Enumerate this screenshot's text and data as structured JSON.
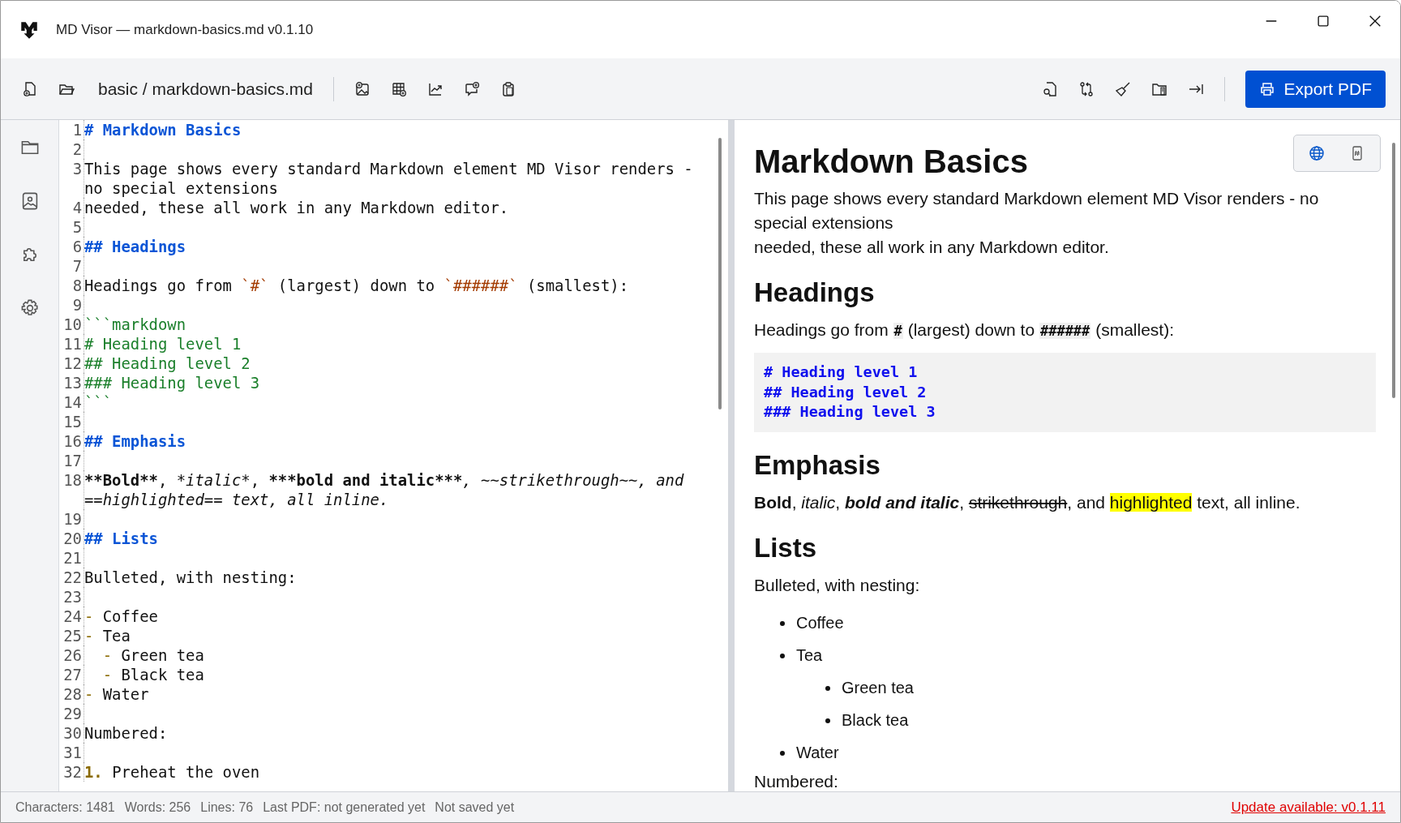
{
  "window": {
    "title": "MD Visor — markdown-basics.md v0.1.10"
  },
  "toolbar": {
    "path": "basic / markdown-basics.md",
    "export_button": "Export PDF"
  },
  "editor": {
    "lines": [
      {
        "number": "1",
        "segments": [
          {
            "kind": "heading",
            "text": "# Markdown Basics"
          }
        ]
      },
      {
        "number": "2"
      },
      {
        "number": "3",
        "segments": [
          {
            "kind": "text",
            "text": "This page shows every standard Markdown element MD Visor renders - no special extensions"
          }
        ]
      },
      {
        "number": "4",
        "segments": [
          {
            "kind": "text",
            "text": "needed, these all work in any Markdown editor."
          }
        ]
      },
      {
        "number": "5"
      },
      {
        "number": "6",
        "segments": [
          {
            "kind": "heading",
            "text": "## Headings"
          }
        ]
      },
      {
        "number": "7"
      },
      {
        "number": "8",
        "segments": [
          {
            "kind": "text",
            "text": "Headings go from "
          },
          {
            "kind": "code",
            "text": "`#`"
          },
          {
            "kind": "text",
            "text": " (largest) down to "
          },
          {
            "kind": "code",
            "text": "`######`"
          },
          {
            "kind": "text",
            "text": " (smallest):"
          }
        ]
      },
      {
        "number": "9"
      },
      {
        "number": "10",
        "segments": [
          {
            "kind": "fence",
            "text": "```markdown"
          }
        ]
      },
      {
        "number": "11",
        "segments": [
          {
            "kind": "fence",
            "text": "# Heading level 1"
          }
        ]
      },
      {
        "number": "12",
        "segments": [
          {
            "kind": "fence",
            "text": "## Heading level 2"
          }
        ]
      },
      {
        "number": "13",
        "segments": [
          {
            "kind": "fence",
            "text": "### Heading level 3"
          }
        ]
      },
      {
        "number": "14",
        "segments": [
          {
            "kind": "fence",
            "text": "```"
          }
        ]
      },
      {
        "number": "15"
      },
      {
        "number": "16",
        "segments": [
          {
            "kind": "heading",
            "text": "## Emphasis"
          }
        ]
      },
      {
        "number": "17"
      },
      {
        "number": "18",
        "segments": [
          {
            "kind": "bold",
            "text": "**Bold**"
          },
          {
            "kind": "text",
            "text": ", "
          },
          {
            "kind": "italic",
            "text": "*italic*"
          },
          {
            "kind": "text",
            "text": ", "
          },
          {
            "kind": "bold",
            "text": "***bold and italic***"
          },
          {
            "kind": "italic",
            "text": ", ~~strikethrough~~, and ==highlighted== text, all inline."
          }
        ]
      },
      {
        "number": "19"
      },
      {
        "number": "20",
        "segments": [
          {
            "kind": "heading",
            "text": "## Lists"
          }
        ]
      },
      {
        "number": "21"
      },
      {
        "number": "22",
        "segments": [
          {
            "kind": "text",
            "text": "Bulleted, with nesting:"
          }
        ]
      },
      {
        "number": "23"
      },
      {
        "number": "24",
        "segments": [
          {
            "kind": "marker",
            "text": "- "
          },
          {
            "kind": "text",
            "text": "Coffee"
          }
        ]
      },
      {
        "number": "25",
        "segments": [
          {
            "kind": "marker",
            "text": "- "
          },
          {
            "kind": "text",
            "text": "Tea"
          }
        ]
      },
      {
        "number": "26",
        "segments": [
          {
            "kind": "marker",
            "text": "  - "
          },
          {
            "kind": "text",
            "text": "Green tea"
          }
        ]
      },
      {
        "number": "27",
        "segments": [
          {
            "kind": "marker",
            "text": "  - "
          },
          {
            "kind": "text",
            "text": "Black tea"
          }
        ]
      },
      {
        "number": "28",
        "segments": [
          {
            "kind": "marker",
            "text": "- "
          },
          {
            "kind": "text",
            "text": "Water"
          }
        ]
      },
      {
        "number": "29"
      },
      {
        "number": "30",
        "segments": [
          {
            "kind": "text",
            "text": "Numbered:"
          }
        ]
      },
      {
        "number": "31"
      },
      {
        "number": "32",
        "segments": [
          {
            "kind": "number",
            "text": "1. "
          },
          {
            "kind": "text",
            "text": "Preheat the oven"
          }
        ]
      }
    ]
  },
  "preview": {
    "blocks": [
      {
        "kind": "h1",
        "segments": [
          {
            "kind": "text",
            "text": "Markdown Basics"
          }
        ]
      },
      {
        "kind": "p",
        "segments": [
          {
            "kind": "text",
            "text": "This page shows every standard Markdown element MD Visor renders - no special extensions\nneeded, these all work in any Markdown editor."
          }
        ]
      },
      {
        "kind": "h2",
        "segments": [
          {
            "kind": "text",
            "text": "Headings"
          }
        ]
      },
      {
        "kind": "p",
        "segments": [
          {
            "kind": "text",
            "text": "Headings go from "
          },
          {
            "kind": "code",
            "text": "#"
          },
          {
            "kind": "text",
            "text": " (largest) down to "
          },
          {
            "kind": "code",
            "text": "######"
          },
          {
            "kind": "text",
            "text": " (smallest):"
          }
        ]
      },
      {
        "kind": "codeblock",
        "lines": [
          "# Heading level 1",
          "## Heading level 2",
          "### Heading level 3"
        ]
      },
      {
        "kind": "h2",
        "segments": [
          {
            "kind": "text",
            "text": "Emphasis"
          }
        ]
      },
      {
        "kind": "p",
        "segments": [
          {
            "kind": "bold",
            "text": "Bold"
          },
          {
            "kind": "text",
            "text": ", "
          },
          {
            "kind": "italic",
            "text": "italic"
          },
          {
            "kind": "text",
            "text": ", "
          },
          {
            "kind": "bolditalic",
            "text": "bold and italic"
          },
          {
            "kind": "text",
            "text": ", "
          },
          {
            "kind": "strike",
            "text": "strikethrough"
          },
          {
            "kind": "text",
            "text": ", and "
          },
          {
            "kind": "mark",
            "text": "highlighted"
          },
          {
            "kind": "text",
            "text": " text, all inline."
          }
        ]
      },
      {
        "kind": "h2",
        "segments": [
          {
            "kind": "text",
            "text": "Lists"
          }
        ]
      },
      {
        "kind": "p",
        "segments": [
          {
            "kind": "text",
            "text": "Bulleted, with nesting:"
          }
        ]
      },
      {
        "kind": "list",
        "items": [
          {
            "text": "Coffee"
          },
          {
            "text": "Tea",
            "children": [
              {
                "text": "Green tea"
              },
              {
                "text": "Black tea"
              }
            ]
          },
          {
            "text": "Water"
          }
        ]
      },
      {
        "kind": "p",
        "segments": [
          {
            "kind": "text",
            "text": "Numbered:"
          }
        ]
      }
    ]
  },
  "status_bar": {
    "items": [
      "Characters: 1481",
      "Words: 256",
      "Lines: 76",
      "Last PDF: not generated yet",
      "Not saved yet"
    ],
    "update_link": "Update available: v0.1.11"
  }
}
